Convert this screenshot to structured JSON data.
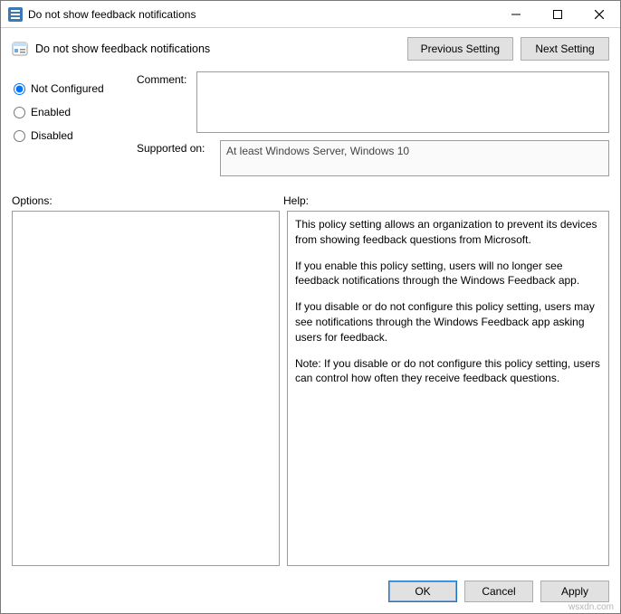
{
  "window": {
    "title": "Do not show feedback notifications"
  },
  "header": {
    "policy_title": "Do not show feedback notifications",
    "prev_btn": "Previous Setting",
    "next_btn": "Next Setting"
  },
  "radios": {
    "not_configured": "Not Configured",
    "enabled": "Enabled",
    "disabled": "Disabled",
    "selected": "not_configured"
  },
  "fields": {
    "comment_label": "Comment:",
    "comment_value": "",
    "supported_label": "Supported on:",
    "supported_value": "At least Windows Server, Windows 10"
  },
  "labels": {
    "options": "Options:",
    "help": "Help:"
  },
  "help": {
    "p1": "This policy setting allows an organization to prevent its devices from showing feedback questions from Microsoft.",
    "p2": "If you enable this policy setting, users will no longer see feedback notifications through the Windows Feedback app.",
    "p3": "If you disable or do not configure this policy setting, users may see notifications through the Windows Feedback app asking users for feedback.",
    "p4": "Note: If you disable or do not configure this policy setting, users can control how often they receive feedback questions."
  },
  "footer": {
    "ok": "OK",
    "cancel": "Cancel",
    "apply": "Apply"
  },
  "watermark": "wsxdn.com"
}
